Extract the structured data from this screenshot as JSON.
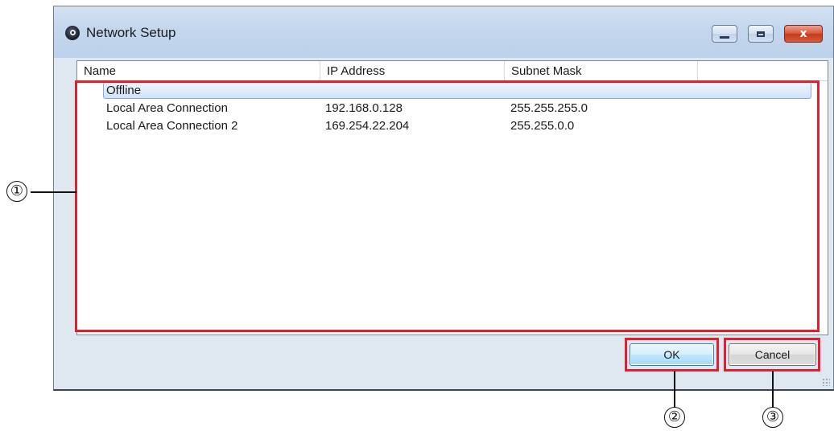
{
  "window": {
    "title": "Network Setup",
    "icon": "app-disc-icon"
  },
  "titlebar_controls": {
    "minimize": "minimize-icon",
    "maximize": "maximize-icon",
    "close": "close-icon",
    "close_glyph": "x"
  },
  "list": {
    "columns": [
      "Name",
      "IP Address",
      "Subnet Mask"
    ],
    "rows": [
      {
        "name": "Offline",
        "ip": "",
        "subnet": "",
        "selected": true
      },
      {
        "name": "Local Area Connection",
        "ip": "192.168.0.128",
        "subnet": "255.255.255.0",
        "selected": false
      },
      {
        "name": "Local Area Connection 2",
        "ip": "169.254.22.204",
        "subnet": "255.255.0.0",
        "selected": false
      }
    ]
  },
  "buttons": {
    "ok": "OK",
    "cancel": "Cancel"
  },
  "annotations": {
    "highlight_color": "#e02030",
    "callouts": [
      "①",
      "②",
      "③"
    ]
  }
}
